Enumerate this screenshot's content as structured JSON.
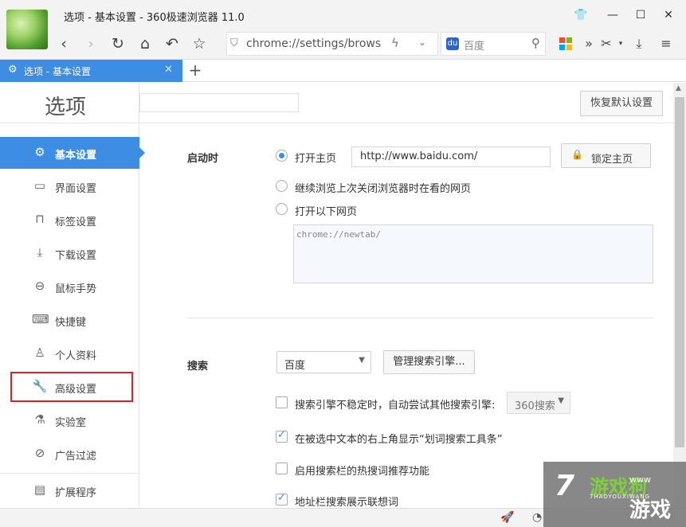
{
  "window": {
    "title": "选项 - 基本设置 - 360极速浏览器 11.0",
    "controls": {
      "skin_icon": "shirt-icon",
      "minimize": "—",
      "maximize": "☐",
      "close": "✕"
    }
  },
  "toolbar": {
    "url": "chrome://settings/browser",
    "search_engine": "百度",
    "icons": [
      "back-icon",
      "forward-icon",
      "refresh-icon",
      "home-icon",
      "undo-icon",
      "star-icon",
      "shield-icon",
      "bolt-icon",
      "chevron-down-icon",
      "search-icon",
      "apps-icon",
      "more-chevron-icon",
      "scissors-icon",
      "download-icon",
      "menu-icon"
    ]
  },
  "tabs": [
    {
      "label": "选项 - 基本设置",
      "active": true
    }
  ],
  "sidebar": {
    "title": "选项",
    "items": [
      {
        "label": "基本设置",
        "icon": "gear-icon",
        "active": true
      },
      {
        "label": "界面设置",
        "icon": "window-icon"
      },
      {
        "label": "标签设置",
        "icon": "tab-icon"
      },
      {
        "label": "下载设置",
        "icon": "download-icon"
      },
      {
        "label": "鼠标手势",
        "icon": "mouse-icon"
      },
      {
        "label": "快捷键",
        "icon": "keyboard-icon"
      },
      {
        "label": "个人资料",
        "icon": "user-icon"
      },
      {
        "label": "高级设置",
        "icon": "wrench-icon",
        "highlighted": true
      },
      {
        "label": "实验室",
        "icon": "flask-icon"
      },
      {
        "label": "广告过滤",
        "icon": "block-icon"
      },
      {
        "label": "扩展程序",
        "icon": "extension-icon"
      }
    ]
  },
  "header": {
    "search_value": "",
    "restore_button": "恢复默认设置"
  },
  "startup": {
    "label": "启动时",
    "option_home": "打开主页",
    "home_url": "http://www.baidu.com/",
    "lock_button": "锁定主页",
    "option_continue": "继续浏览上次关闭浏览器时在看的网页",
    "option_pages": "打开以下网页",
    "pages_text": "chrome://newtab/"
  },
  "search": {
    "label": "搜索",
    "engine": "百度",
    "manage_button": "管理搜索引擎...",
    "fallback_text": "搜索引擎不稳定时，自动尝试其他搜索引擎:",
    "fallback_engine": "360搜索",
    "toolbar_text": "在被选中文本的右上角显示“划词搜索工具条”",
    "hotwords_text": "启用搜索栏的热搜词推荐功能",
    "suggest_text": "地址栏搜索展示联想词"
  },
  "watermark": {
    "num": "7",
    "big": "游戏狗",
    "sub": "7HAOYOUXIWANG",
    "big2": "游戏",
    "www": "www"
  },
  "colors": {
    "accent": "#3d8de5",
    "highlight_box": "#d9232a"
  }
}
